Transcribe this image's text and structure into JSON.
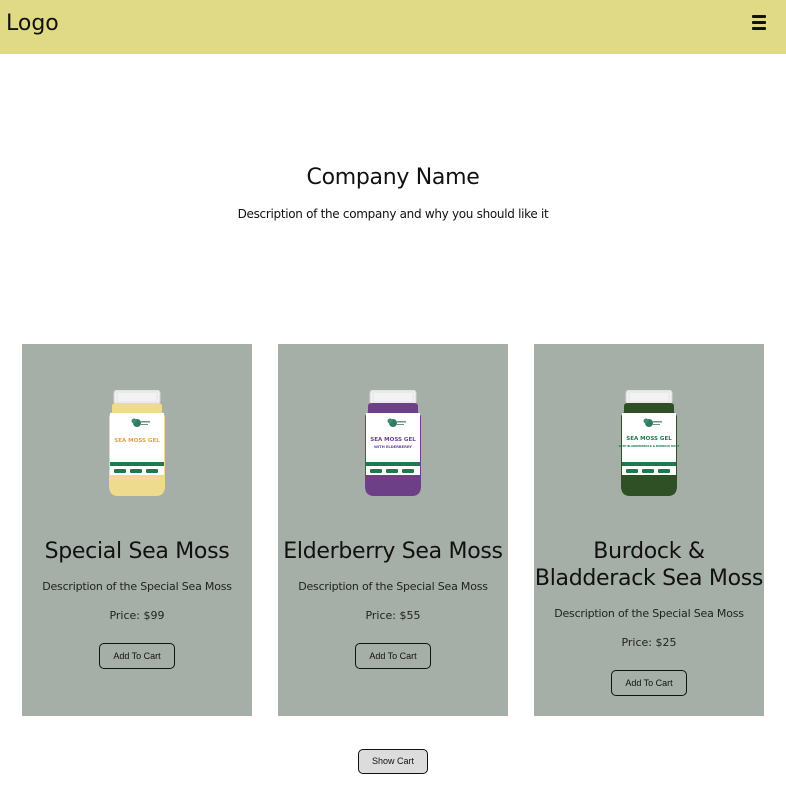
{
  "navbar": {
    "logo": "Logo",
    "menu_icon": "hamburger-menu-icon"
  },
  "hero": {
    "title": "Company Name",
    "description": "Description of the company and why you should like it"
  },
  "products": [
    {
      "title": "Special Sea Moss",
      "description": "Description of the Special Sea Moss",
      "price": "Price: $99",
      "button": "Add To Cart",
      "jar": {
        "label": "SEA MOSS GEL",
        "sub": "",
        "fill": "#efdb8e",
        "text_color": "#e2a14a"
      }
    },
    {
      "title": "Elderberry Sea Moss",
      "description": "Description of the Special Sea Moss",
      "price": "Price: $55",
      "button": "Add To Cart",
      "jar": {
        "label": "SEA MOSS GEL",
        "sub": "WITH ELDERBERRY",
        "fill": "#6c3f86",
        "text_color": "#6a3f93"
      }
    },
    {
      "title": "Burdock & Bladderack Sea Moss",
      "description": "Description of the Special Sea Moss",
      "price": "Price: $25",
      "button": "Add To Cart",
      "jar": {
        "label": "SEA MOSS GEL",
        "sub": "WITH BLADDERWRACK & BURDOCK ROOT",
        "fill": "#2f4f24",
        "text_color": "#1f7a4a"
      }
    }
  ],
  "footer": {
    "show_cart": "Show Cart"
  }
}
